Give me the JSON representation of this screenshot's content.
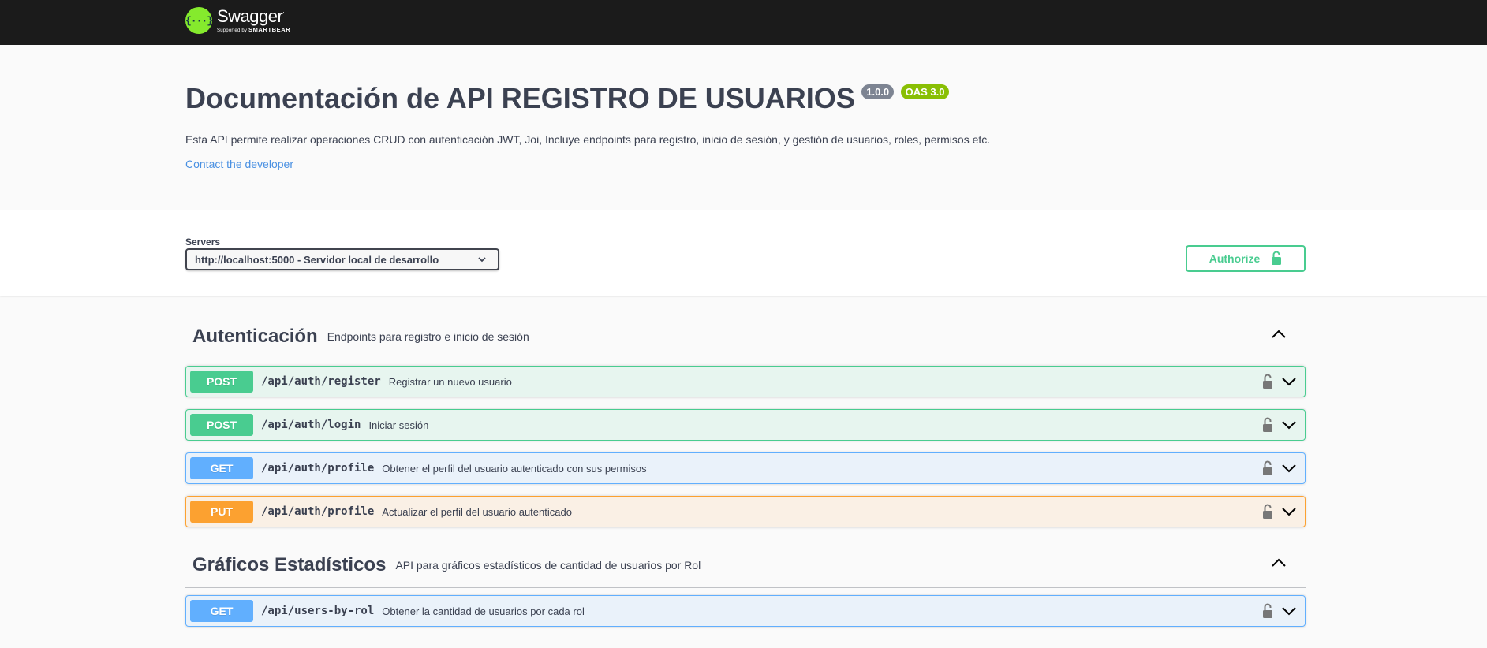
{
  "topbar": {
    "logo_symbol": "{···}",
    "logo_word": "Swagger",
    "logo_tm": ".",
    "logo_supported_prefix": "Supported by",
    "logo_supported_brand": "SMARTBEAR"
  },
  "info": {
    "title": "Documentación de API REGISTRO DE USUARIOS",
    "version_badge": "1.0.0",
    "oas_badge": "OAS 3.0",
    "description": "Esta API permite realizar operaciones CRUD con autenticación JWT, Joi, Incluye endpoints para registro, inicio de sesión, y gestión de usuarios, roles, permisos etc.",
    "contact_link": "Contact the developer"
  },
  "servers": {
    "label": "Servers",
    "selected": "http://localhost:5000 - Servidor local de desarrollo"
  },
  "authorize": {
    "label": "Authorize"
  },
  "tags": [
    {
      "name": "Autenticación",
      "description": "Endpoints para registro e inicio de sesión",
      "operations": [
        {
          "method": "POST",
          "path": "/api/auth/register",
          "summary": "Registrar un nuevo usuario"
        },
        {
          "method": "POST",
          "path": "/api/auth/login",
          "summary": "Iniciar sesión"
        },
        {
          "method": "GET",
          "path": "/api/auth/profile",
          "summary": "Obtener el perfil del usuario autenticado con sus permisos"
        },
        {
          "method": "PUT",
          "path": "/api/auth/profile",
          "summary": "Actualizar el perfil del usuario autenticado"
        }
      ]
    },
    {
      "name": "Gráficos Estadísticos",
      "description": "API para gráficos estadísticos de cantidad de usuarios por Rol",
      "operations": [
        {
          "method": "GET",
          "path": "/api/users-by-rol",
          "summary": "Obtener la cantidad de usuarios por cada rol"
        }
      ]
    }
  ],
  "colors": {
    "post": "#49cc90",
    "get": "#61affe",
    "put": "#fca130",
    "topbar": "#1b1b1b",
    "logo": "#85ea2d"
  },
  "icons": {
    "lock": "lock-icon",
    "chevron_down": "chevron-down-icon",
    "chevron_up": "chevron-up-icon"
  }
}
